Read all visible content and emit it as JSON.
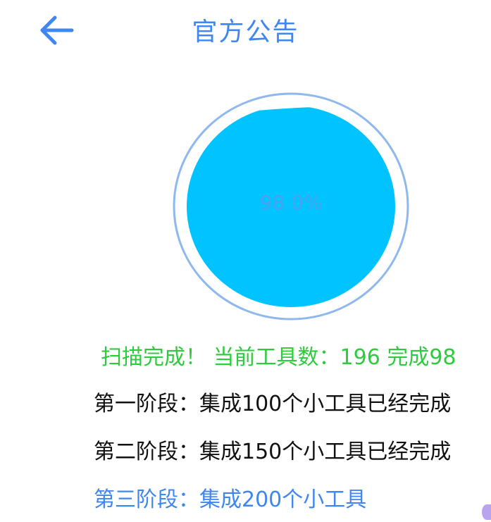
{
  "header": {
    "back_icon": "arrow-left-icon",
    "title": "官方公告"
  },
  "gauge": {
    "label": "98.0%",
    "fill_fraction": 0.98,
    "fill_color": "#00c3ff",
    "ring_color": "#8fb8ee"
  },
  "status": {
    "text": "扫描完成！ 当前工具数：196  完成98",
    "color": "#2fcb3f"
  },
  "stages": [
    {
      "text": "第一阶段：集成100个小工具已经完成"
    },
    {
      "text": "第二阶段：集成150个小工具已经完成"
    },
    {
      "text": "第三阶段：集成200个小工具"
    }
  ],
  "colors": {
    "accent": "#3f86f1"
  }
}
